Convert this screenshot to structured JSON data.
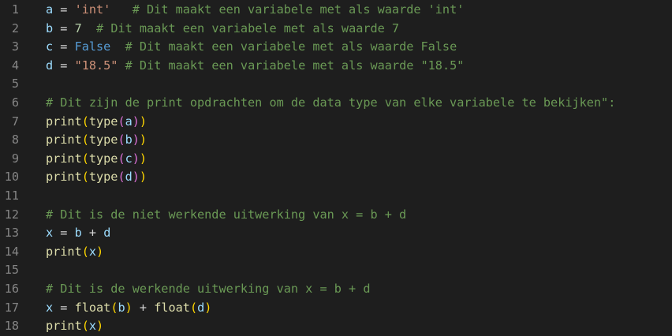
{
  "editor": {
    "line_numbers": [
      "1",
      "2",
      "3",
      "4",
      "5",
      "6",
      "7",
      "8",
      "9",
      "10",
      "11",
      "12",
      "13",
      "14",
      "15",
      "16",
      "17",
      "18"
    ],
    "lines": [
      [
        [
          "var",
          "a"
        ],
        [
          "op",
          " = "
        ],
        [
          "str",
          "'int'"
        ],
        [
          "op",
          "   "
        ],
        [
          "com",
          "# Dit maakt een variabele met als waarde 'int'"
        ]
      ],
      [
        [
          "var",
          "b"
        ],
        [
          "op",
          " = "
        ],
        [
          "num",
          "7"
        ],
        [
          "op",
          "  "
        ],
        [
          "com",
          "# Dit maakt een variabele met als waarde 7"
        ]
      ],
      [
        [
          "var",
          "c"
        ],
        [
          "op",
          " = "
        ],
        [
          "kw",
          "False"
        ],
        [
          "op",
          "  "
        ],
        [
          "com",
          "# Dit maakt een variabele met als waarde False"
        ]
      ],
      [
        [
          "var",
          "d"
        ],
        [
          "op",
          " = "
        ],
        [
          "str",
          "\"18.5\""
        ],
        [
          "op",
          " "
        ],
        [
          "com",
          "# Dit maakt een variabele met als waarde \"18.5\""
        ]
      ],
      [],
      [
        [
          "com",
          "# Dit zijn de print opdrachten om de data type van elke variabele te bekijken\":"
        ]
      ],
      [
        [
          "fn",
          "print"
        ],
        [
          "br1",
          "("
        ],
        [
          "fn",
          "type"
        ],
        [
          "br2",
          "("
        ],
        [
          "var",
          "a"
        ],
        [
          "br2",
          ")"
        ],
        [
          "br1",
          ")"
        ]
      ],
      [
        [
          "fn",
          "print"
        ],
        [
          "br1",
          "("
        ],
        [
          "fn",
          "type"
        ],
        [
          "br2",
          "("
        ],
        [
          "var",
          "b"
        ],
        [
          "br2",
          ")"
        ],
        [
          "br1",
          ")"
        ]
      ],
      [
        [
          "fn",
          "print"
        ],
        [
          "br1",
          "("
        ],
        [
          "fn",
          "type"
        ],
        [
          "br2",
          "("
        ],
        [
          "var",
          "c"
        ],
        [
          "br2",
          ")"
        ],
        [
          "br1",
          ")"
        ]
      ],
      [
        [
          "fn",
          "print"
        ],
        [
          "br1",
          "("
        ],
        [
          "fn",
          "type"
        ],
        [
          "br2",
          "("
        ],
        [
          "var",
          "d"
        ],
        [
          "br2",
          ")"
        ],
        [
          "br1",
          ")"
        ]
      ],
      [],
      [
        [
          "com",
          "# Dit is de niet werkende uitwerking van x = b + d"
        ]
      ],
      [
        [
          "var",
          "x"
        ],
        [
          "op",
          " = "
        ],
        [
          "var",
          "b"
        ],
        [
          "op",
          " + "
        ],
        [
          "var",
          "d"
        ]
      ],
      [
        [
          "fn",
          "print"
        ],
        [
          "br1",
          "("
        ],
        [
          "var",
          "x"
        ],
        [
          "br1",
          ")"
        ]
      ],
      [],
      [
        [
          "com",
          "# Dit is de werkende uitwerking van x = b + d"
        ]
      ],
      [
        [
          "var",
          "x"
        ],
        [
          "op",
          " = "
        ],
        [
          "fn",
          "float"
        ],
        [
          "br1",
          "("
        ],
        [
          "var",
          "b"
        ],
        [
          "br1",
          ")"
        ],
        [
          "op",
          " + "
        ],
        [
          "fn",
          "float"
        ],
        [
          "br1",
          "("
        ],
        [
          "var",
          "d"
        ],
        [
          "br1",
          ")"
        ]
      ],
      [
        [
          "fn",
          "print"
        ],
        [
          "br1",
          "("
        ],
        [
          "var",
          "x"
        ],
        [
          "br1",
          ")"
        ]
      ]
    ]
  }
}
